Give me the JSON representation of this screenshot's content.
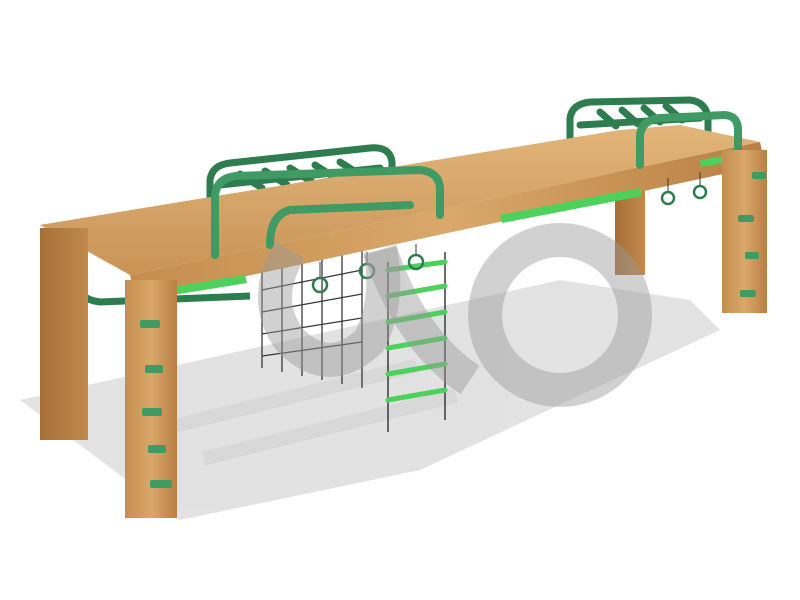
{
  "image": {
    "subject": "wooden-playground-climbing-frame",
    "background": "#ffffff",
    "watermark": "kompan-style-logo"
  },
  "colors": {
    "wood_light": "#d9a86a",
    "wood_mid": "#c48d4f",
    "wood_dark": "#a56f37",
    "green_dark": "#2e7d4f",
    "green_mid": "#3f9a63",
    "green_bright": "#4cd25c",
    "shadow": "#dcdcdc",
    "net": "#3a3a3a",
    "watermark": "#9a9a9a"
  }
}
